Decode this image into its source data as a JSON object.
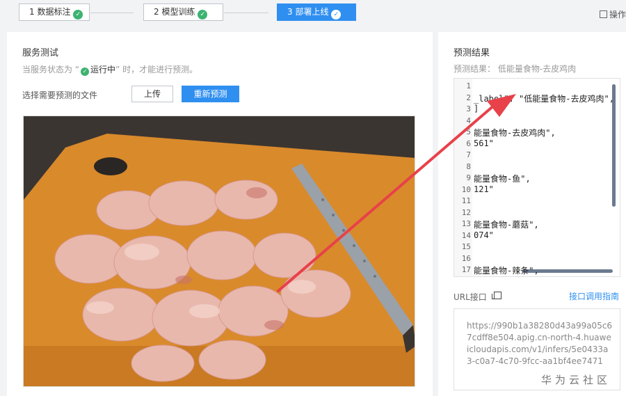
{
  "steps": [
    {
      "label": "1 数据标注"
    },
    {
      "label": "2 模型训练"
    },
    {
      "label": "3 部署上线"
    }
  ],
  "ops_label": "操作",
  "service_test": {
    "title": "服务测试",
    "hint_prefix": "当服务状态为 “",
    "hint_status": "运行中",
    "hint_suffix": "” 时，才能进行预测。",
    "file_label": "选择需要预测的文件",
    "upload_label": "上传",
    "repredict_label": "重新预测"
  },
  "result": {
    "title": "预测结果",
    "summary": "预测结果： 低能量食物-去皮鸡肉",
    "code_lines": [
      {
        "n": "1",
        "t": ""
      },
      {
        "n": "2",
        "t": "_label\": \"低能量食物-去皮鸡肉\","
      },
      {
        "n": "3",
        "t": "]"
      },
      {
        "n": "4",
        "t": ""
      },
      {
        "n": "5",
        "t": "能量食物-去皮鸡肉\","
      },
      {
        "n": "6",
        "t": "561\""
      },
      {
        "n": "7",
        "t": ""
      },
      {
        "n": "8",
        "t": ""
      },
      {
        "n": "9",
        "t": "能量食物-鱼\","
      },
      {
        "n": "10",
        "t": "121\""
      },
      {
        "n": "11",
        "t": ""
      },
      {
        "n": "12",
        "t": ""
      },
      {
        "n": "13",
        "t": "能量食物-蘑菇\","
      },
      {
        "n": "14",
        "t": "074\""
      },
      {
        "n": "15",
        "t": ""
      },
      {
        "n": "16",
        "t": ""
      },
      {
        "n": "17",
        "t": "能量食物-辣条\","
      }
    ]
  },
  "url": {
    "label": "URL接口",
    "link": "接口调用指南",
    "value": "https://990b1a38280d43a99a05c67cdff8e504.apig.cn-north-4.huaweicloudapis.com/v1/infers/5e0433a3-c0a7-4c70-9fcc-aa1bf4ee7471"
  },
  "watermark": "华为云社区",
  "colors": {
    "primary": "#2f8ff0",
    "success": "#3cb371",
    "arrow": "#e8414a"
  }
}
